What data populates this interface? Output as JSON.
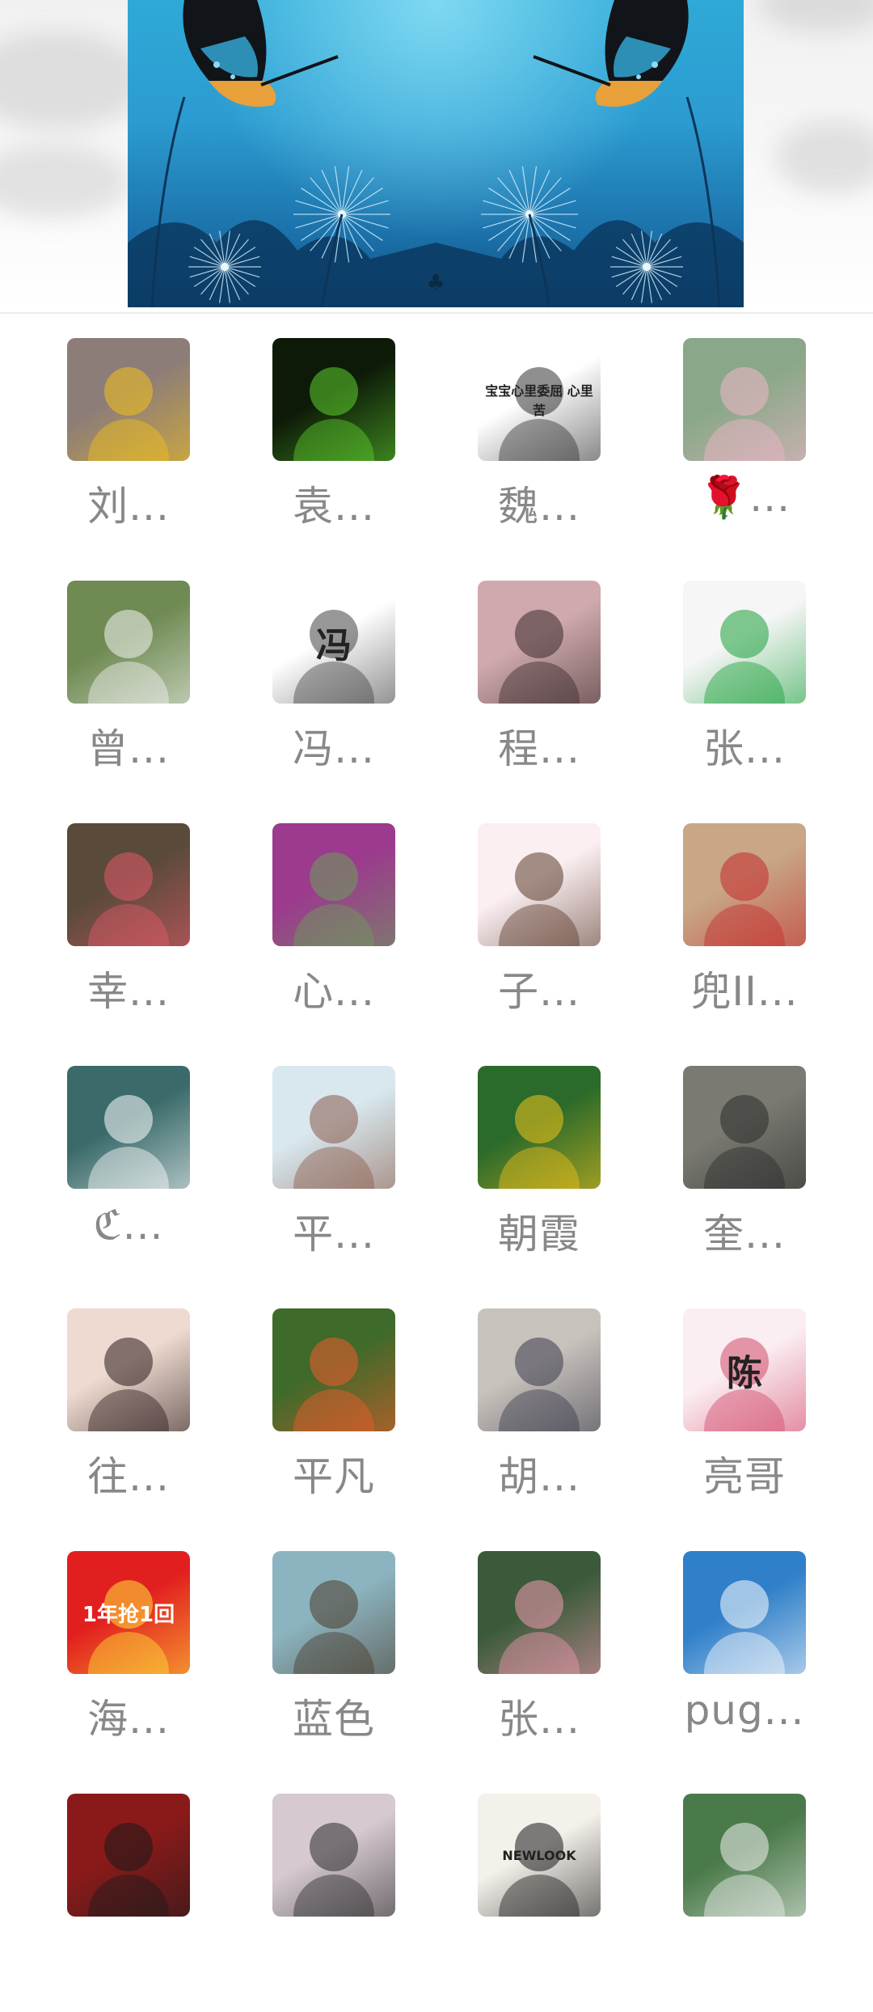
{
  "banner": {
    "title": "",
    "emblem": "club-symbol",
    "palette": [
      "#2fa9d8",
      "#1b6fa8",
      "#0f4d7e"
    ]
  },
  "members": [
    {
      "name": "刘...",
      "avatar": {
        "kind": "portrait-sunflower",
        "colors": [
          "#8d7d78",
          "#f2c11c"
        ],
        "text": ""
      }
    },
    {
      "name": "袁...",
      "avatar": {
        "kind": "green-mandala",
        "colors": [
          "#0d1a08",
          "#5fcf2e"
        ],
        "text": ""
      }
    },
    {
      "name": "魏...",
      "avatar": {
        "kind": "cartoon-bear",
        "colors": [
          "#ffffff",
          "#333333"
        ],
        "text": "宝宝心里委屈 心里苦"
      }
    },
    {
      "name": "🌹...",
      "avatar": {
        "kind": "hand-blossom",
        "colors": [
          "#8aa889",
          "#f2b6c9"
        ],
        "text": ""
      }
    },
    {
      "name": "曾...",
      "avatar": {
        "kind": "chef-outdoor",
        "colors": [
          "#6f8a52",
          "#f4f4f4"
        ],
        "text": ""
      }
    },
    {
      "name": "冯...",
      "avatar": {
        "kind": "circle-portrait-card",
        "colors": [
          "#ffffff",
          "#444444"
        ],
        "text": "冯"
      }
    },
    {
      "name": "程...",
      "avatar": {
        "kind": "woman-pink",
        "colors": [
          "#cfa9ad",
          "#3a2a2a"
        ],
        "text": ""
      }
    },
    {
      "name": "张...",
      "avatar": {
        "kind": "woman-green",
        "colors": [
          "#f6f6f6",
          "#1aa03a"
        ],
        "text": ""
      }
    },
    {
      "name": "幸...",
      "avatar": {
        "kind": "group-photo",
        "colors": [
          "#5a4a3a",
          "#e35a6a"
        ],
        "text": ""
      }
    },
    {
      "name": "心...",
      "avatar": {
        "kind": "flower-bed",
        "colors": [
          "#9c3a8d",
          "#6aa05a"
        ],
        "text": ""
      }
    },
    {
      "name": "子...",
      "avatar": {
        "kind": "cartoon-family",
        "colors": [
          "#fbeff2",
          "#5a3a2a"
        ],
        "text": ""
      }
    },
    {
      "name": "兜II...",
      "avatar": {
        "kind": "illustrated-woman",
        "colors": [
          "#c8a686",
          "#c42a2a"
        ],
        "text": ""
      }
    },
    {
      "name": "ℭ...",
      "avatar": {
        "kind": "white-lotus",
        "colors": [
          "#3a6a6a",
          "#ffffff"
        ],
        "text": ""
      }
    },
    {
      "name": "平...",
      "avatar": {
        "kind": "woman-selfie",
        "colors": [
          "#d8e8ee",
          "#8a5a4a"
        ],
        "text": ""
      }
    },
    {
      "name": "朝霞",
      "avatar": {
        "kind": "woman-garden",
        "colors": [
          "#2a6a2a",
          "#f2c21c"
        ],
        "text": ""
      }
    },
    {
      "name": "奎...",
      "avatar": {
        "kind": "man-glasses",
        "colors": [
          "#7a7a72",
          "#2a2a2a"
        ],
        "text": ""
      }
    },
    {
      "name": "往...",
      "avatar": {
        "kind": "woman-closeup",
        "colors": [
          "#eedad0",
          "#2a1a1a"
        ],
        "text": ""
      }
    },
    {
      "name": "平凡",
      "avatar": {
        "kind": "orange-flowers",
        "colors": [
          "#3e6a2a",
          "#f25a2a"
        ],
        "text": ""
      }
    },
    {
      "name": "胡...",
      "avatar": {
        "kind": "person-hallway",
        "colors": [
          "#c8c2bc",
          "#3a3a4a"
        ],
        "text": ""
      }
    },
    {
      "name": "亮哥",
      "avatar": {
        "kind": "love-card",
        "colors": [
          "#fbeef2",
          "#d24a6a"
        ],
        "text": "陈"
      }
    },
    {
      "name": "海...",
      "avatar": {
        "kind": "red-promo",
        "colors": [
          "#e21f1f",
          "#ffe23a"
        ],
        "text": "1年抢1回"
      }
    },
    {
      "name": "蓝色",
      "avatar": {
        "kind": "woman-portrait",
        "colors": [
          "#8cb4c0",
          "#4a3a2a"
        ],
        "text": ""
      }
    },
    {
      "name": "张...",
      "avatar": {
        "kind": "pink-roses",
        "colors": [
          "#3a5a3a",
          "#f09ab0"
        ],
        "text": ""
      }
    },
    {
      "name": "pug...",
      "avatar": {
        "kind": "dandelion",
        "colors": [
          "#2f7fc9",
          "#ffffff"
        ],
        "text": ""
      }
    },
    {
      "name": "",
      "avatar": {
        "kind": "illustrated-sunglasses",
        "colors": [
          "#8a1a1a",
          "#1a1a1a"
        ],
        "text": ""
      }
    },
    {
      "name": "",
      "avatar": {
        "kind": "woman-bob",
        "colors": [
          "#d6c9d2",
          "#2a2a2a"
        ],
        "text": ""
      }
    },
    {
      "name": "",
      "avatar": {
        "kind": "newlook-store",
        "colors": [
          "#f4f0ea",
          "#1a1a1a"
        ],
        "text": "NEWLOOK"
      }
    },
    {
      "name": "",
      "avatar": {
        "kind": "group-outdoor",
        "colors": [
          "#4a7a4a",
          "#f2f2f2"
        ],
        "text": ""
      }
    }
  ]
}
